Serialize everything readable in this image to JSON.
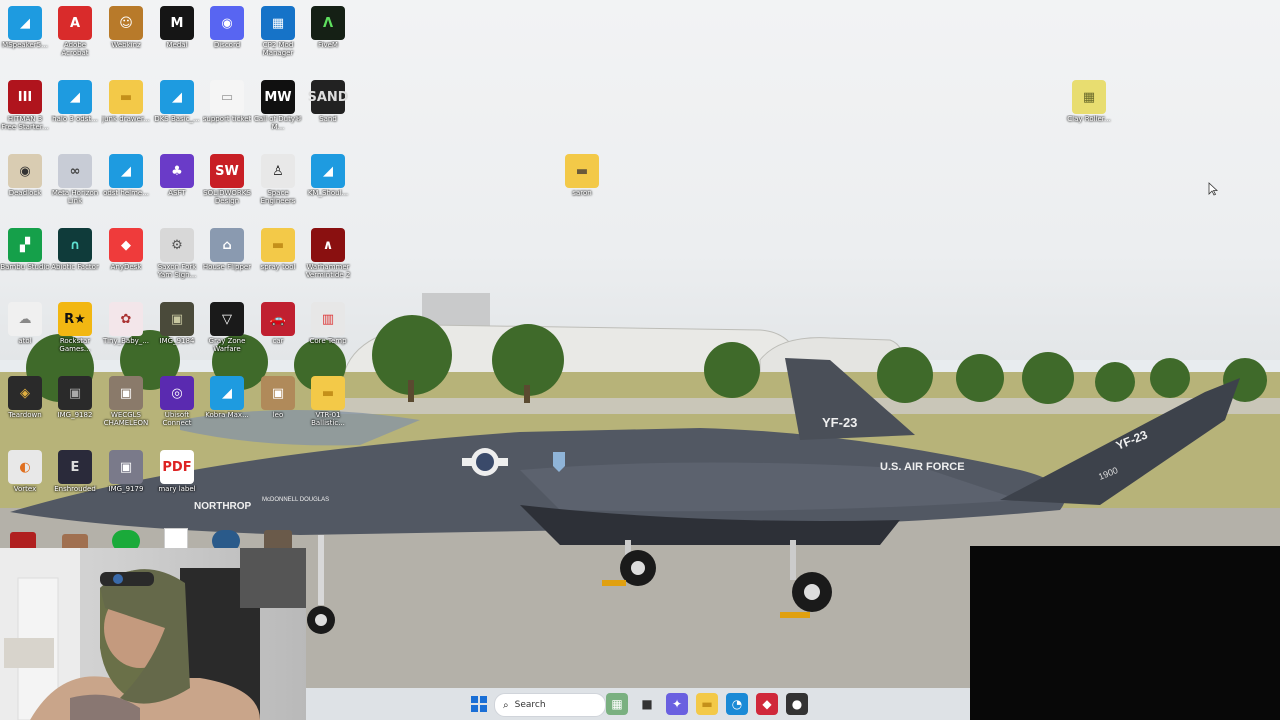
{
  "desktop": {
    "icons": [
      {
        "label": "MSpeaker5...",
        "glyph": "◢",
        "bg": "#1e9be0",
        "fg": "#fff"
      },
      {
        "label": "Adobe Acrobat",
        "glyph": "A",
        "bg": "#d92b2b",
        "fg": "#fff"
      },
      {
        "label": "Webkinz",
        "glyph": "☺",
        "bg": "#b87a2a",
        "fg": "#fff"
      },
      {
        "label": "Medal",
        "glyph": "M",
        "bg": "#151515",
        "fg": "#fff"
      },
      {
        "label": "Discord",
        "glyph": "◉",
        "bg": "#5865f2",
        "fg": "#fff"
      },
      {
        "label": "CP2 Mod Manager",
        "glyph": "▦",
        "bg": "#1673c8",
        "fg": "#fff"
      },
      {
        "label": "FiveM",
        "glyph": "Λ",
        "bg": "#152015",
        "fg": "#5fe05f"
      },
      {
        "label": "HITMAN 3 Free Starter...",
        "glyph": "III",
        "bg": "#b0141d",
        "fg": "#fff"
      },
      {
        "label": "halo 3 odst...",
        "glyph": "◢",
        "bg": "#1e9be0",
        "fg": "#fff"
      },
      {
        "label": "junk drawer...",
        "glyph": "▬",
        "bg": "#f3c948",
        "fg": "#c4901a"
      },
      {
        "label": "DKS Basic_...",
        "glyph": "◢",
        "bg": "#1e9be0",
        "fg": "#fff"
      },
      {
        "label": "support ticket",
        "glyph": "▭",
        "bg": "#f5f5f5",
        "fg": "#999"
      },
      {
        "label": "Call of Duty® M...",
        "glyph": "MW",
        "bg": "#101010",
        "fg": "#fff"
      },
      {
        "label": "Sand",
        "glyph": "SAND",
        "bg": "#222",
        "fg": "#ddd"
      },
      {
        "label": "Deadlock",
        "glyph": "◉",
        "bg": "#d9ccb2",
        "fg": "#333"
      },
      {
        "label": "Meta Horizon Link",
        "glyph": "∞",
        "bg": "#c8ccd6",
        "fg": "#444"
      },
      {
        "label": "odst helme...",
        "glyph": "◢",
        "bg": "#1e9be0",
        "fg": "#fff"
      },
      {
        "label": "ASFT",
        "glyph": "♣",
        "bg": "#6a3bc8",
        "fg": "#fff"
      },
      {
        "label": "SOLIDWORKS Design",
        "glyph": "SW",
        "bg": "#c81f25",
        "fg": "#fff"
      },
      {
        "label": "Space Engineers",
        "glyph": "♙",
        "bg": "#e8e8e8",
        "fg": "#222"
      },
      {
        "label": "KM_Shoul...",
        "glyph": "◢",
        "bg": "#1e9be0",
        "fg": "#fff"
      },
      {
        "label": "Bambu Studio",
        "glyph": "▞",
        "bg": "#15a04a",
        "fg": "#fff"
      },
      {
        "label": "Abiotic Factor",
        "glyph": "∩",
        "bg": "#0f3b3a",
        "fg": "#5ee0d0"
      },
      {
        "label": "AnyDesk",
        "glyph": "◆",
        "bg": "#ef3b3b",
        "fg": "#fff"
      },
      {
        "label": "Saxon Fork Yam Sign...",
        "glyph": "⚙",
        "bg": "#d8d8d8",
        "fg": "#555"
      },
      {
        "label": "House Flipper",
        "glyph": "⌂",
        "bg": "#8a9ab0",
        "fg": "#fff"
      },
      {
        "label": "spray tool",
        "glyph": "▬",
        "bg": "#f3c948",
        "fg": "#c4901a"
      },
      {
        "label": "Warhammer Vermintide 2",
        "glyph": "∧",
        "bg": "#8a1010",
        "fg": "#fff"
      },
      {
        "label": "atol",
        "glyph": "☁",
        "bg": "#f0f0f0",
        "fg": "#888"
      },
      {
        "label": "Rockstar Games...",
        "glyph": "R★",
        "bg": "#f2b712",
        "fg": "#111"
      },
      {
        "label": "Tiny_Baby_...",
        "glyph": "✿",
        "bg": "#f3e6ea",
        "fg": "#a33"
      },
      {
        "label": "IMG_9184",
        "glyph": "▣",
        "bg": "#4a4a3a",
        "fg": "#c8c8a0"
      },
      {
        "label": "Gray Zone Warfare",
        "glyph": "▽",
        "bg": "#1a1a1a",
        "fg": "#fff"
      },
      {
        "label": "car",
        "glyph": "🚗",
        "bg": "#c02030",
        "fg": "#fff"
      },
      {
        "label": "Core Temp",
        "glyph": "▥",
        "bg": "#e7e7e7",
        "fg": "#d33"
      },
      {
        "label": "Teardown",
        "glyph": "◈",
        "bg": "#2a2a2a",
        "fg": "#e0b040"
      },
      {
        "label": "IMG_9182",
        "glyph": "▣",
        "bg": "#2a2a2a",
        "fg": "#aaa"
      },
      {
        "label": "WECGLS CHAMELEON",
        "glyph": "▣",
        "bg": "#8a7a6a",
        "fg": "#fff"
      },
      {
        "label": "Ubisoft Connect",
        "glyph": "◎",
        "bg": "#5a2ab0",
        "fg": "#fff"
      },
      {
        "label": "Kobra Max...",
        "glyph": "◢",
        "bg": "#1e9be0",
        "fg": "#fff"
      },
      {
        "label": "leo",
        "glyph": "▣",
        "bg": "#b08a5a",
        "fg": "#fff"
      },
      {
        "label": "VTR-01 Ballistic...",
        "glyph": "▬",
        "bg": "#f3c948",
        "fg": "#c4901a"
      },
      {
        "label": "Vortex",
        "glyph": "◐",
        "bg": "#e8e8e8",
        "fg": "#e07020"
      },
      {
        "label": "Enshrouded",
        "glyph": "E",
        "bg": "#2a2a3a",
        "fg": "#ddd"
      },
      {
        "label": "IMG_9179",
        "glyph": "▣",
        "bg": "#7a7a8a",
        "fg": "#fff"
      },
      {
        "label": "mary label",
        "glyph": "PDF",
        "bg": "#ffffff",
        "fg": "#d22"
      }
    ],
    "extra_icons": [
      {
        "label": "saron",
        "glyph": "▬",
        "bg": "#f3c948",
        "fg": "#6a5a3a"
      },
      {
        "label": "Clay Roller...",
        "glyph": "▦",
        "bg": "#e8dd70",
        "fg": "#6a6a2a"
      }
    ]
  },
  "wallpaper": {
    "aircraft_tail_text": "YF-23",
    "aircraft_body_text": "U.S. AIR FORCE",
    "aircraft_tail_text_2": "YF-23",
    "aircraft_serial": "1900",
    "aircraft_maker_text": "NORTHROP",
    "aircraft_maker_text_2": "McDONNELL DOUGLAS"
  },
  "taskbar": {
    "search_placeholder": "Search",
    "items": [
      {
        "name": "start-button",
        "glyph": "⊞",
        "bg": "transparent",
        "fg": "#1a6fd6"
      },
      {
        "name": "widgets-button",
        "glyph": "▦",
        "bg": "#7ab080",
        "fg": "#fff"
      },
      {
        "name": "task-view-button",
        "glyph": "■",
        "bg": "transparent",
        "fg": "#333"
      },
      {
        "name": "copilot-button",
        "glyph": "✦",
        "bg": "#6a60e0",
        "fg": "#fff"
      },
      {
        "name": "file-explorer-button",
        "glyph": "▬",
        "bg": "#f3c948",
        "fg": "#c4901a"
      },
      {
        "name": "edge-button",
        "glyph": "◔",
        "bg": "#1a8ad6",
        "fg": "#fff"
      },
      {
        "name": "app-button-red",
        "glyph": "◆",
        "bg": "#d0283a",
        "fg": "#fff"
      },
      {
        "name": "app-button-dark",
        "glyph": "●",
        "bg": "#333",
        "fg": "#fff"
      }
    ]
  }
}
